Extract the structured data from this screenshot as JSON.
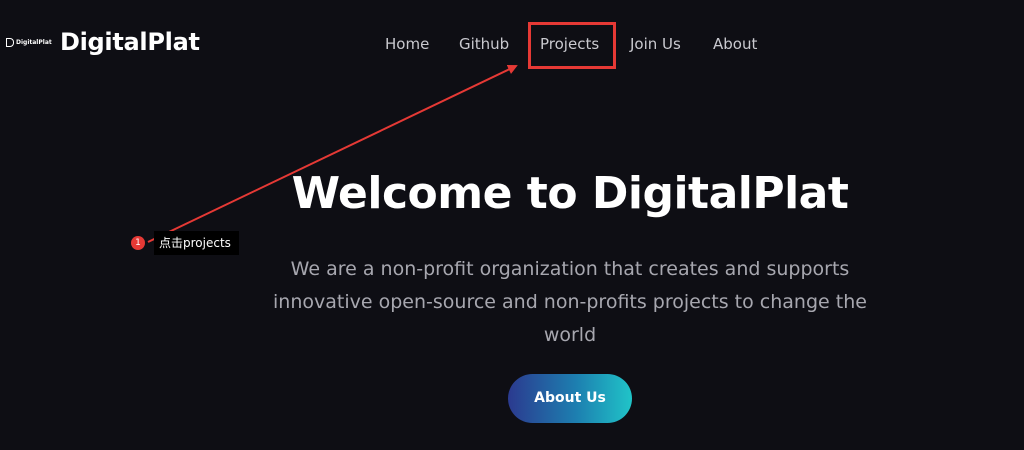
{
  "header": {
    "logo_small_text": "DigitalPlat",
    "brand": "DigitalPlat",
    "nav": {
      "home": "Home",
      "github": "Github",
      "projects": "Projects",
      "join": "Join Us",
      "about": "About"
    }
  },
  "hero": {
    "title": "Welcome to DigitalPlat",
    "subtitle": "We are a non-profit organization that creates and supports innovative open-source and non-profits projects to change the world",
    "cta_label": "About Us"
  },
  "annotation": {
    "step_number": "1",
    "step_text": "点击projects",
    "accent_color": "#e53935"
  },
  "colors": {
    "background": "#0e0e14",
    "cta_gradient_start": "#2b3a8f",
    "cta_gradient_end": "#20c4c8"
  }
}
